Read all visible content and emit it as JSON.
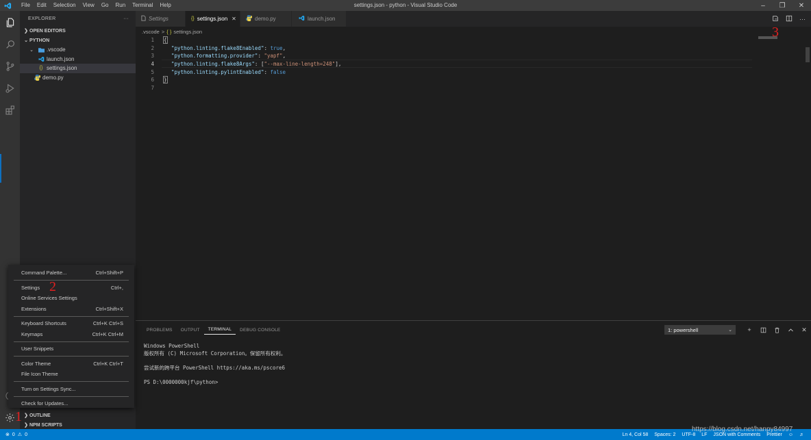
{
  "window": {
    "title": "settings.json - python - Visual Studio Code",
    "menu": [
      "File",
      "Edit",
      "Selection",
      "View",
      "Go",
      "Run",
      "Terminal",
      "Help"
    ]
  },
  "colors": {
    "accent": "#007acc",
    "activity_bar": "#333333",
    "sidebar": "#252526",
    "editor": "#1e1e1e",
    "annotation": "#e02020"
  },
  "activity_icons": [
    "files-icon",
    "search-icon",
    "source-control-icon",
    "run-debug-icon",
    "extensions-icon",
    "account-icon",
    "gear-icon"
  ],
  "sidebar": {
    "title": "EXPLORER",
    "more": "···",
    "open_editors": "OPEN EDITORS",
    "folder": "PYTHON",
    "tree": [
      {
        "label": ".vscode",
        "icon": "folder-icon"
      },
      {
        "label": "launch.json",
        "icon": "vscode-file-icon"
      },
      {
        "label": "settings.json",
        "icon": "json-icon"
      },
      {
        "label": "demo.py",
        "icon": "python-icon"
      }
    ],
    "outline": "OUTLINE",
    "npm_scripts": "NPM SCRIPTS"
  },
  "tabs": [
    {
      "label": "Settings",
      "icon": "file-icon"
    },
    {
      "label": "settings.json",
      "icon": "json-icon",
      "close": "✕"
    },
    {
      "label": "demo.py",
      "icon": "python-icon"
    },
    {
      "label": "launch.json",
      "icon": "vscode-file-icon"
    }
  ],
  "breadcrumb": {
    "folder": ".vscode",
    "sep": ">",
    "file_icon": "{ }",
    "file": "settings.json"
  },
  "code": {
    "line_numbers": [
      "1",
      "2",
      "3",
      "4",
      "5",
      "6",
      "7"
    ],
    "open_brace": "{",
    "close_brace": "}",
    "line2_key": "\"python.linting.flake8Enabled\"",
    "line2_val": "true",
    "line3_key": "\"python.formatting.provider\"",
    "line3_val": "\"yapf\"",
    "line4_key": "\"python.linting.flake8Args\"",
    "line4_val": "\"--max-line-length=248\"",
    "line5_key": "\"python.linting.pylintEnabled\"",
    "line5_val": "false"
  },
  "panel": {
    "tabs": [
      "PROBLEMS",
      "OUTPUT",
      "TERMINAL",
      "DEBUG CONSOLE"
    ],
    "terminal_select": "1: powershell",
    "terminal_lines": [
      "Windows PowerShell",
      "版权所有 (C) Microsoft Corporation。保留所有权利。",
      "",
      "尝试新的跨平台 PowerShell https://aka.ms/pscore6",
      "",
      "PS D:\\0000000kjf\\python>"
    ]
  },
  "menu": {
    "items": [
      {
        "label": "Command Palette...",
        "shortcut": "Ctrl+Shift+P"
      },
      {
        "label": "Settings",
        "shortcut": "Ctrl+,"
      },
      {
        "label": "Online Services Settings",
        "shortcut": ""
      },
      {
        "label": "Extensions",
        "shortcut": "Ctrl+Shift+X"
      },
      {
        "label": "Keyboard Shortcuts",
        "shortcut": "Ctrl+K Ctrl+S"
      },
      {
        "label": "Keymaps",
        "shortcut": "Ctrl+K Ctrl+M"
      },
      {
        "label": "User Snippets",
        "shortcut": ""
      },
      {
        "label": "Color Theme",
        "shortcut": "Ctrl+K Ctrl+T"
      },
      {
        "label": "File Icon Theme",
        "shortcut": ""
      },
      {
        "label": "Turn on Settings Sync...",
        "shortcut": ""
      },
      {
        "label": "Check for Updates...",
        "shortcut": ""
      }
    ]
  },
  "annotations": {
    "one": "1",
    "two": "2",
    "three": "3"
  },
  "statusbar": {
    "errors": "0",
    "warnings": "0",
    "position": "Ln 4, Col 58",
    "spaces": "Spaces: 2",
    "encoding": "UTF-8",
    "eol": "LF",
    "language": "JSON with Comments",
    "prettier": "Prettier"
  },
  "watermark": "https://blog.csdn.net/hanpy84997"
}
